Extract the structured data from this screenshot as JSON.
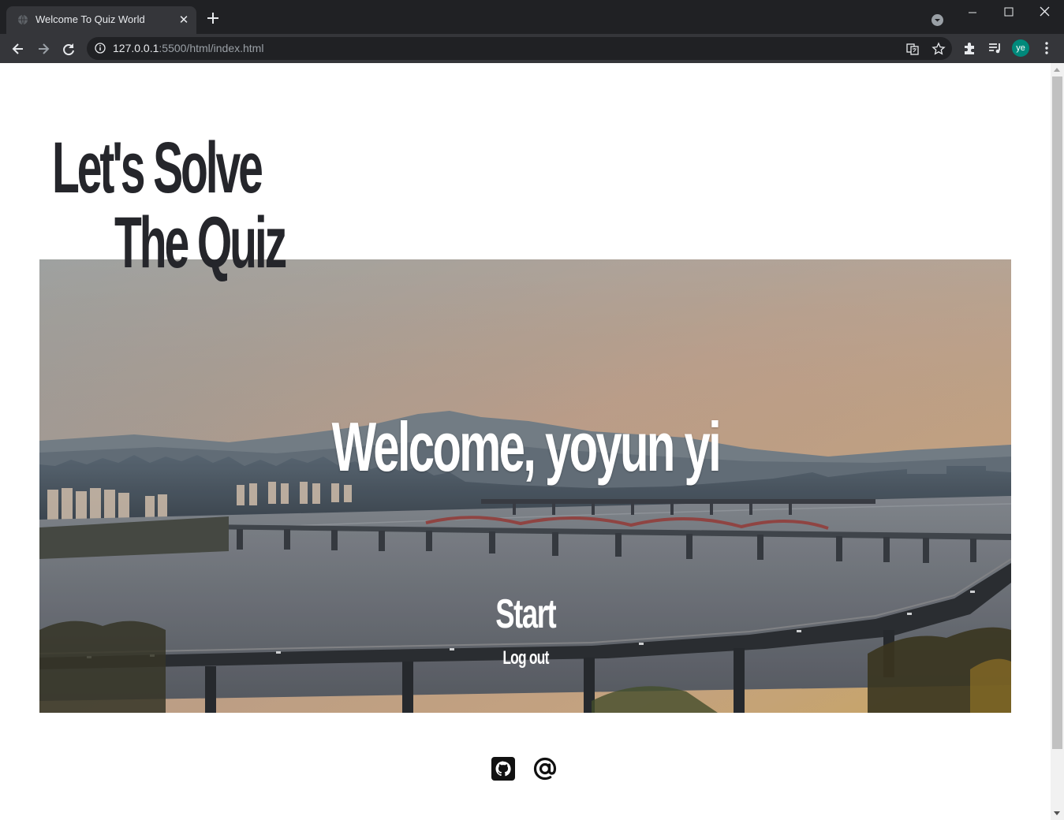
{
  "browser": {
    "tab_title": "Welcome To Quiz World",
    "url_host": "127.0.0.1",
    "url_rest": ":5500/html/index.html",
    "profile_initials": "ye",
    "profile_color": "#00897b"
  },
  "page": {
    "headline_line1": "Let's Solve",
    "headline_line2": "The Quiz",
    "welcome_text": "Welcome, yoyun yi",
    "start_label": "Start",
    "logout_label": "Log out",
    "footer_icons": [
      "github-icon",
      "at-sign-icon"
    ],
    "headline_color": "#25262b"
  }
}
